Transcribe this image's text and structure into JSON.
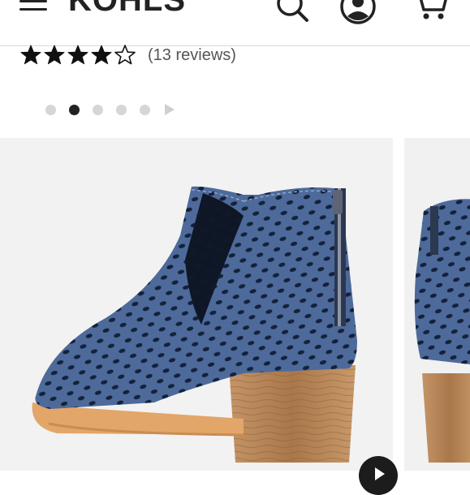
{
  "header": {
    "logo": "KOHĽS",
    "icons": {
      "menu": "hamburger-menu-icon",
      "search": "search-icon",
      "account": "account-icon",
      "cart": "shopping-cart-icon"
    }
  },
  "product": {
    "rating": 4,
    "rating_max": 5,
    "reviews_label": "(13 reviews)"
  },
  "carousel": {
    "slide_count": 5,
    "active_index": 1
  },
  "colors": {
    "text_dark": "#222222",
    "dot_inactive": "#d6d6d6",
    "boot_blue": "#4d6a9a",
    "heel_wood": "#b98a5c"
  }
}
